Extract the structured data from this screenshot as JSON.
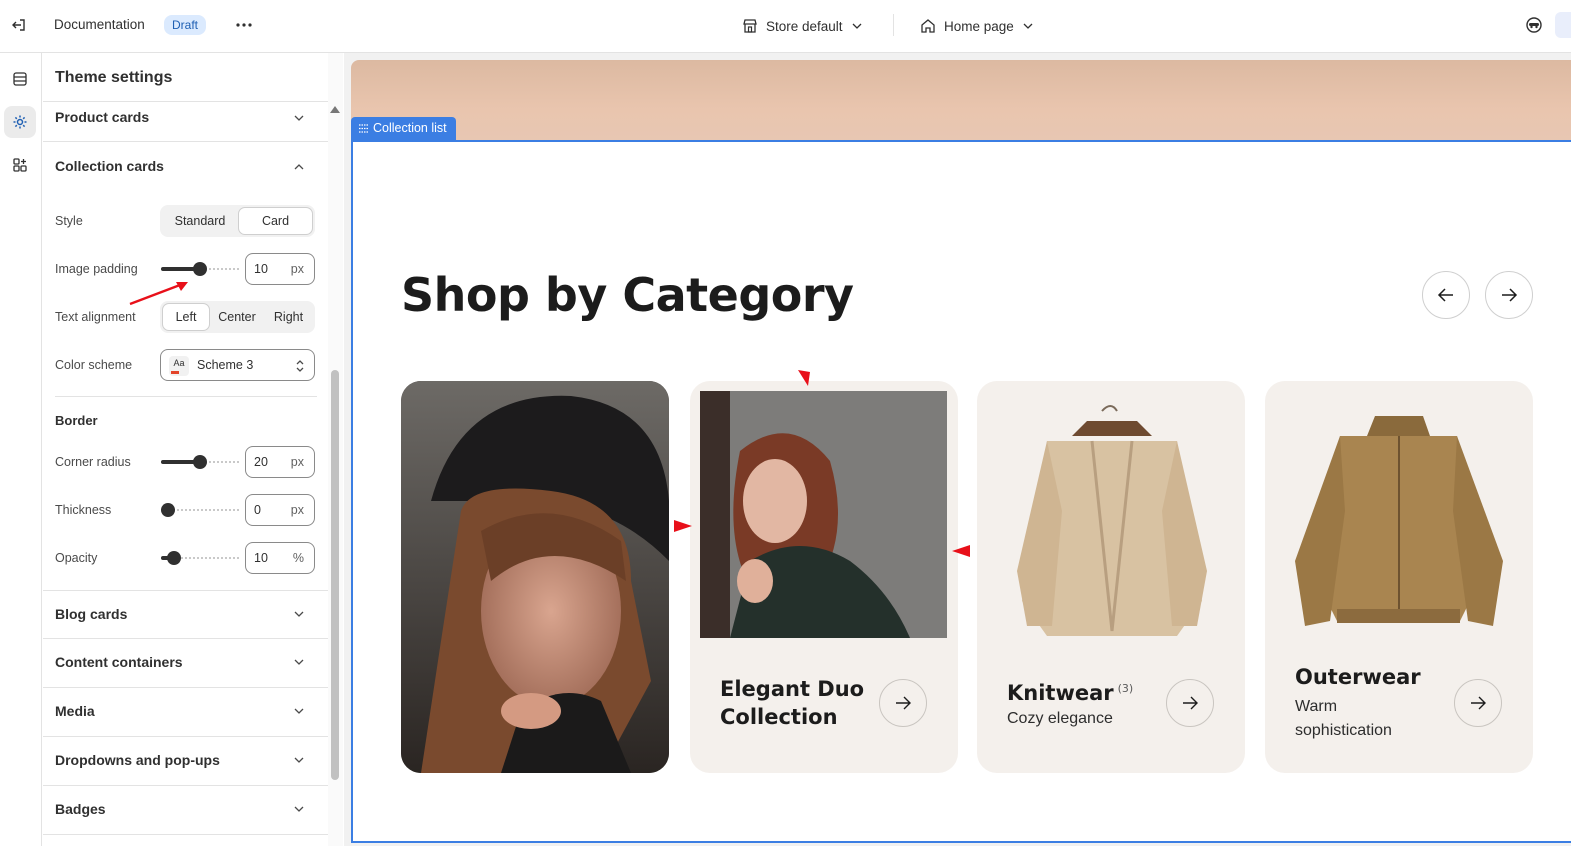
{
  "topbar": {
    "doc_title": "Documentation",
    "status_badge": "Draft",
    "store_selector": "Store default",
    "page_selector": "Home page"
  },
  "panel": {
    "title": "Theme settings",
    "sections": {
      "product_cards": "Product cards",
      "collection_cards": "Collection cards",
      "blog_cards": "Blog cards",
      "content_containers": "Content containers",
      "media": "Media",
      "dropdowns": "Dropdowns and pop-ups",
      "badges": "Badges"
    },
    "collection_cards": {
      "style_label": "Style",
      "style_options": [
        "Standard",
        "Card"
      ],
      "style_selected": "Card",
      "image_padding_label": "Image padding",
      "image_padding_value": "10",
      "image_padding_unit": "px",
      "text_alignment_label": "Text alignment",
      "text_alignment_options": [
        "Left",
        "Center",
        "Right"
      ],
      "text_alignment_selected": "Left",
      "color_scheme_label": "Color scheme",
      "color_scheme_swatch": "Aa",
      "color_scheme_value": "Scheme 3",
      "border_heading": "Border",
      "corner_radius_label": "Corner radius",
      "corner_radius_value": "20",
      "corner_radius_unit": "px",
      "thickness_label": "Thickness",
      "thickness_value": "0",
      "thickness_unit": "px",
      "opacity_label": "Opacity",
      "opacity_value": "10",
      "opacity_unit": "%"
    }
  },
  "preview": {
    "section_tag": "Collection list",
    "heading": "Shop by Category",
    "cards": [
      {
        "title": "",
        "subtitle": ""
      },
      {
        "title": "Elegant Duo Collection",
        "subtitle": ""
      },
      {
        "title": "Knitwear",
        "count": "(3)",
        "subtitle": "Cozy elegance"
      },
      {
        "title": "Outerwear",
        "subtitle": "Warm sophistication"
      }
    ]
  },
  "colors": {
    "accent_blue": "#3b7ee3",
    "card_bg": "#f4f0ec",
    "annotation_red": "#e8101a"
  }
}
